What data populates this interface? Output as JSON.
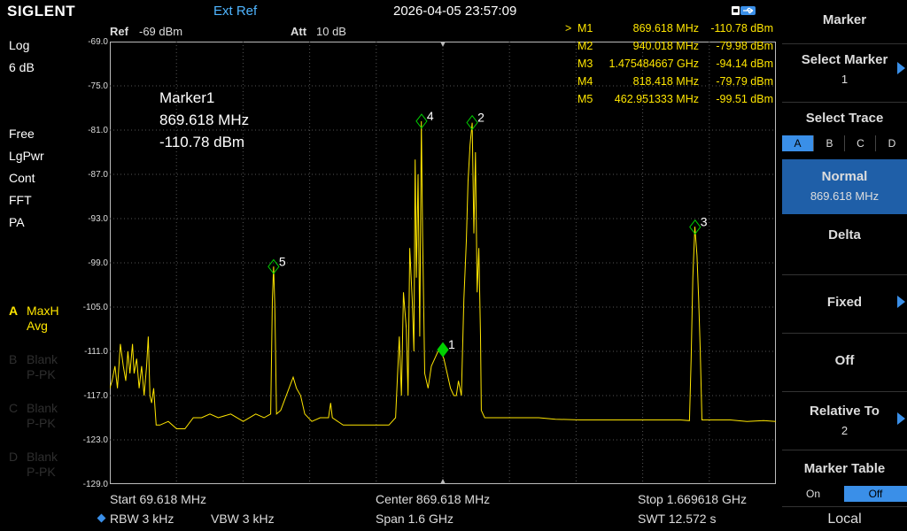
{
  "topbar": {
    "logo": "SIGLENT",
    "ext_ref": "Ext Ref",
    "datetime": "2026-04-05 23:57:09"
  },
  "left": {
    "scale_type": "Log",
    "scale_div": "6 dB",
    "mode1": "Free",
    "mode2": "LgPwr",
    "mode3": "Cont",
    "mode4": "FFT",
    "mode5": "PA",
    "traces": [
      {
        "letter": "A",
        "l1": "MaxH",
        "l2": "Avg"
      },
      {
        "letter": "B",
        "l1": "Blank",
        "l2": "P-PK"
      },
      {
        "letter": "C",
        "l1": "Blank",
        "l2": "P-PK"
      },
      {
        "letter": "D",
        "l1": "Blank",
        "l2": "P-PK"
      }
    ]
  },
  "header": {
    "ref_label": "Ref",
    "ref_value": "-69 dBm",
    "att_label": "Att",
    "att_value": "10 dB"
  },
  "yaxis": [
    "-69.0",
    "-75.0",
    "-81.0",
    "-87.0",
    "-93.0",
    "-99.0",
    "-105.0",
    "-111.0",
    "-117.0",
    "-123.0",
    "-129.0"
  ],
  "marker_readout": {
    "title": "Marker1",
    "freq": "869.618 MHz",
    "level": "-110.78 dBm"
  },
  "marker_table": [
    {
      "sel": ">",
      "name": "M1",
      "freq": "869.618 MHz",
      "level": "-110.78 dBm"
    },
    {
      "sel": "",
      "name": "M2",
      "freq": "940.018 MHz",
      "level": "-79.98 dBm"
    },
    {
      "sel": "",
      "name": "M3",
      "freq": "1.475484667 GHz",
      "level": "-94.14 dBm"
    },
    {
      "sel": "",
      "name": "M4",
      "freq": "818.418 MHz",
      "level": "-79.79 dBm"
    },
    {
      "sel": "",
      "name": "M5",
      "freq": "462.951333 MHz",
      "level": "-99.51 dBm"
    }
  ],
  "chart_data": {
    "type": "line",
    "xlim_mhz": [
      69.618,
      1669.618
    ],
    "ylim_dbm": [
      -129,
      -69
    ],
    "grid": true,
    "markers": [
      {
        "label": "1",
        "x_mhz": 869.618,
        "y_dbm": -110.78
      },
      {
        "label": "2",
        "x_mhz": 940.018,
        "y_dbm": -79.98
      },
      {
        "label": "3",
        "x_mhz": 1475.484667,
        "y_dbm": -94.14
      },
      {
        "label": "4",
        "x_mhz": 818.418,
        "y_dbm": -79.79
      },
      {
        "label": "5",
        "x_mhz": 462.951333,
        "y_dbm": -99.51
      }
    ],
    "trace_points": [
      [
        69.6,
        -116
      ],
      [
        75,
        -115
      ],
      [
        82,
        -113
      ],
      [
        88,
        -116
      ],
      [
        95,
        -110
      ],
      [
        102,
        -113
      ],
      [
        108,
        -115
      ],
      [
        113,
        -111
      ],
      [
        118,
        -114
      ],
      [
        124,
        -110
      ],
      [
        128,
        -114
      ],
      [
        134,
        -112
      ],
      [
        140,
        -116
      ],
      [
        146,
        -113
      ],
      [
        152,
        -117
      ],
      [
        158,
        -113
      ],
      [
        162,
        -109
      ],
      [
        166,
        -117
      ],
      [
        170,
        -118
      ],
      [
        175,
        -116
      ],
      [
        181,
        -121
      ],
      [
        190,
        -121
      ],
      [
        210,
        -120.5
      ],
      [
        230,
        -121.5
      ],
      [
        250,
        -121.5
      ],
      [
        270,
        -120
      ],
      [
        290,
        -120
      ],
      [
        310,
        -119.5
      ],
      [
        330,
        -120
      ],
      [
        360,
        -119.5
      ],
      [
        390,
        -120.5
      ],
      [
        420,
        -119.5
      ],
      [
        440,
        -120
      ],
      [
        456,
        -119.5
      ],
      [
        460,
        -104
      ],
      [
        463,
        -99.5
      ],
      [
        466,
        -105
      ],
      [
        470,
        -119.5
      ],
      [
        480,
        -119
      ],
      [
        490,
        -117.5
      ],
      [
        500,
        -116
      ],
      [
        510,
        -114.5
      ],
      [
        518,
        -116
      ],
      [
        528,
        -117
      ],
      [
        538,
        -119.5
      ],
      [
        555,
        -120.5
      ],
      [
        575,
        -120
      ],
      [
        595,
        -120
      ],
      [
        600,
        -118
      ],
      [
        604,
        -120
      ],
      [
        630,
        -121
      ],
      [
        660,
        -121
      ],
      [
        700,
        -121
      ],
      [
        740,
        -121
      ],
      [
        756,
        -120
      ],
      [
        765,
        -109
      ],
      [
        770,
        -117
      ],
      [
        775,
        -103
      ],
      [
        782,
        -108
      ],
      [
        786,
        -117
      ],
      [
        790,
        -97
      ],
      [
        796,
        -104
      ],
      [
        800,
        -111
      ],
      [
        803,
        -85
      ],
      [
        806,
        -101
      ],
      [
        810,
        -87
      ],
      [
        814,
        -109
      ],
      [
        818,
        -79.8
      ],
      [
        821,
        -95
      ],
      [
        826,
        -114
      ],
      [
        834,
        -116
      ],
      [
        842,
        -113
      ],
      [
        850,
        -112
      ],
      [
        858,
        -111
      ],
      [
        865,
        -110.8
      ],
      [
        872,
        -112
      ],
      [
        880,
        -114
      ],
      [
        888,
        -116
      ],
      [
        896,
        -117
      ],
      [
        902,
        -117
      ],
      [
        907,
        -115
      ],
      [
        914,
        -117
      ],
      [
        920,
        -104
      ],
      [
        926,
        -96
      ],
      [
        930,
        -88
      ],
      [
        935,
        -83
      ],
      [
        940,
        -80
      ],
      [
        944,
        -95
      ],
      [
        948,
        -84
      ],
      [
        952,
        -103
      ],
      [
        956,
        -97
      ],
      [
        960,
        -109
      ],
      [
        962,
        -119
      ],
      [
        970,
        -120
      ],
      [
        990,
        -120
      ],
      [
        1020,
        -120
      ],
      [
        1060,
        -120
      ],
      [
        1100,
        -120
      ],
      [
        1140,
        -120.2
      ],
      [
        1200,
        -120.3
      ],
      [
        1260,
        -120.3
      ],
      [
        1320,
        -120.3
      ],
      [
        1380,
        -120.3
      ],
      [
        1440,
        -120.3
      ],
      [
        1462,
        -120.4
      ],
      [
        1466,
        -112
      ],
      [
        1470,
        -101
      ],
      [
        1475,
        -94.1
      ],
      [
        1480,
        -98
      ],
      [
        1484,
        -104
      ],
      [
        1488,
        -111
      ],
      [
        1492,
        -120.3
      ],
      [
        1520,
        -120.3
      ],
      [
        1560,
        -120.3
      ],
      [
        1600,
        -120.5
      ],
      [
        1640,
        -120.4
      ],
      [
        1669.6,
        -120.5
      ]
    ]
  },
  "bottom": {
    "start": "Start  69.618 MHz",
    "center": "Center  869.618 MHz",
    "stop": "Stop  1.669618 GHz",
    "rbw": "RBW  3 kHz",
    "vbw": "VBW  3 kHz",
    "span": "Span  1.6 GHz",
    "swt": "SWT  12.572 s"
  },
  "panel": {
    "title": "Marker",
    "select_marker": "Select Marker",
    "select_marker_value": "1",
    "select_trace": "Select Trace",
    "trace_options": [
      "A",
      "B",
      "C",
      "D"
    ],
    "trace_selected": "A",
    "normal": "Normal",
    "normal_value": "869.618 MHz",
    "delta": "Delta",
    "fixed": "Fixed",
    "off": "Off",
    "relative_to": "Relative To",
    "relative_value": "2",
    "marker_table": "Marker Table",
    "table_on": "On",
    "table_off": "Off",
    "local": "Local"
  },
  "colors": {
    "trace": "#ffe600",
    "accent": "#3a8fe8",
    "selected_bg": "#1f5fa8",
    "marker_active": "#00d000",
    "ext_ref": "#4fb5ff"
  }
}
